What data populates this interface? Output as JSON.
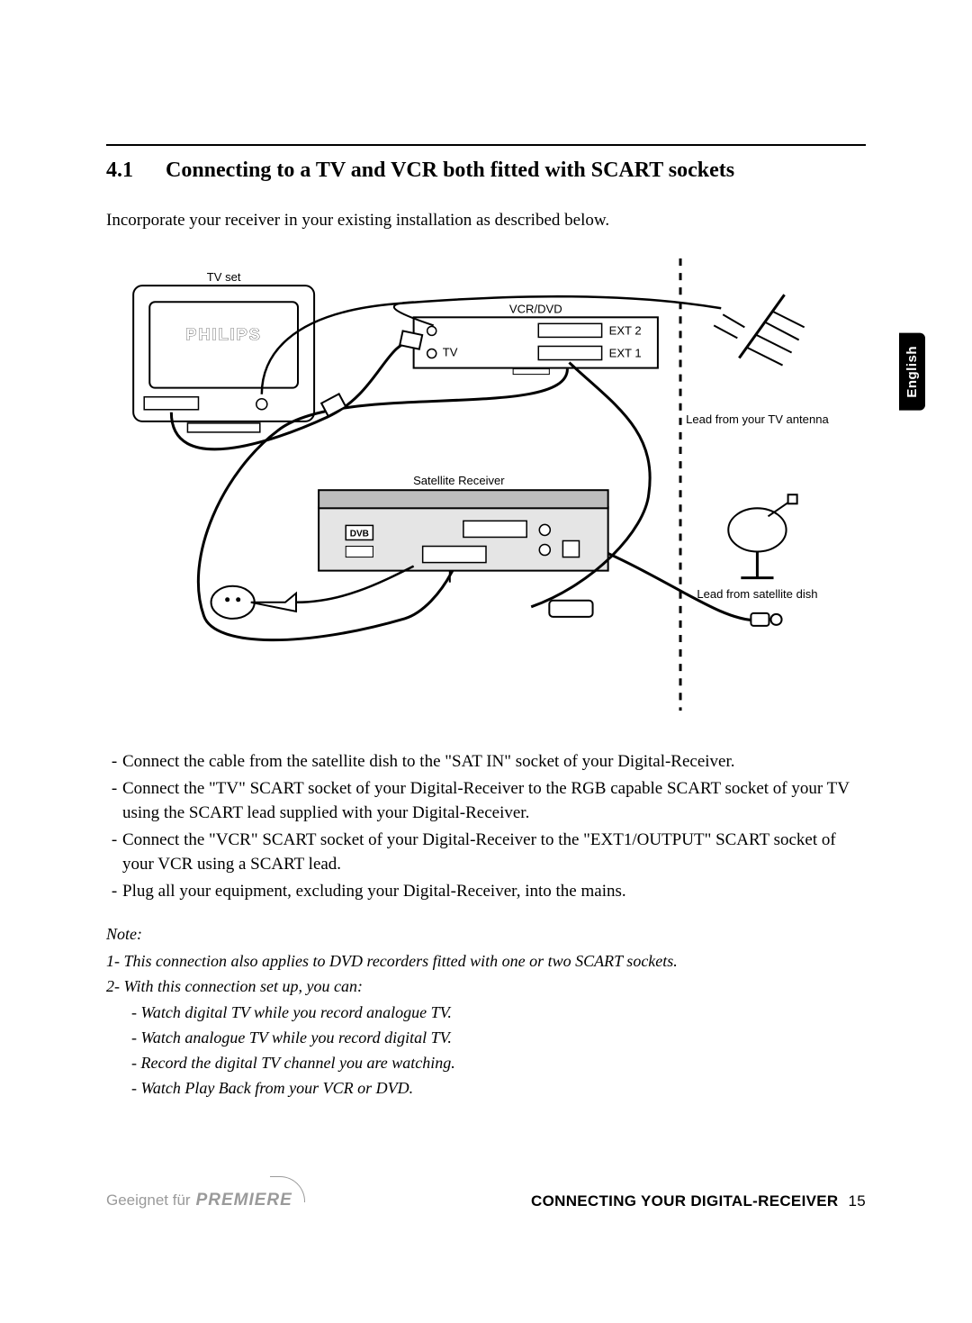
{
  "heading": {
    "number": "4.1",
    "title": "Connecting to a TV and VCR both fitted with SCART sockets"
  },
  "intro": "Incorporate your receiver in your existing installation as described below.",
  "diagram_labels": {
    "tvset": "TV set",
    "tvbrand": "PHILIPS",
    "vcrdvd": "VCR/DVD",
    "ext1": "EXT 1",
    "ext2": "EXT 2",
    "tv_port": "TV",
    "satreceiver": "Satellite Receiver",
    "dvb": "DVB",
    "lead_antenna": "Lead from your TV antenna",
    "lead_dish": "Lead from satellite dish"
  },
  "bullets": [
    "Connect the cable from the satellite dish to the \"SAT IN\" socket of your Digital-Receiver.",
    "Connect the \"TV\" SCART socket of your Digital-Receiver to the RGB capable SCART socket of your TV using the SCART lead supplied with your Digital-Receiver.",
    "Connect the \"VCR\" SCART socket of your Digital-Receiver to the \"EXT1/OUTPUT\" SCART socket of your VCR using a SCART lead.",
    "Plug all your equipment, excluding your Digital-Receiver, into the mains."
  ],
  "note_label": "Note:",
  "notes": {
    "n1": "1- This connection also applies to DVD recorders fitted with one or two SCART sockets.",
    "n2": "2- With this connection set up, you can:",
    "subs": [
      "- Watch digital TV while you record analogue TV.",
      "- Watch analogue TV while you record digital TV.",
      "- Record the digital TV channel you are watching.",
      "- Watch Play Back from your VCR or DVD."
    ]
  },
  "footer": {
    "geeignet": "Geeignet für",
    "premiere": "PREMIERE",
    "section": "CONNECTING YOUR DIGITAL-RECEIVER",
    "page": "15"
  },
  "lang_tab": "English"
}
